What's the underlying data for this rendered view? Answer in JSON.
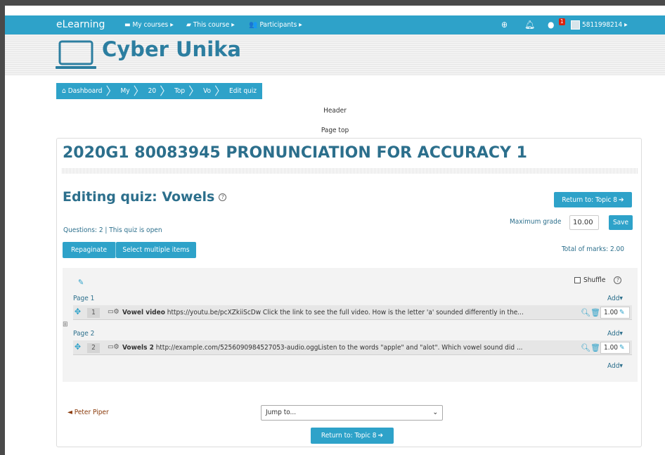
{
  "navbar": {
    "brand": "eLearning",
    "my_courses": "My courses",
    "this_course": "This course",
    "participants": "Participants",
    "message_badge": "1",
    "user_id": "5811998214"
  },
  "header": {
    "site_name": "Cyber Unika"
  },
  "breadcrumb": {
    "items": [
      "Dashboard",
      "My",
      "20",
      "Top",
      "Vo",
      "Edit quiz"
    ]
  },
  "regions": {
    "header_label": "Header",
    "page_top_label": "Page top"
  },
  "course": {
    "title": "2020G1 80083945 PRONUNCIATION FOR ACCURACY 1"
  },
  "quiz": {
    "editing_title": "Editing quiz: Vowels",
    "return_button": "Return to: Topic 8",
    "questions_info": "Questions: 2 | This quiz is open",
    "max_grade_label": "Maximum grade",
    "max_grade_value": "10.00",
    "save_button": "Save",
    "repaginate_button": "Repaginate",
    "select_multiple_button": "Select multiple items",
    "total_marks": "Total of marks: 2.00",
    "shuffle_label": "Shuffle",
    "add_label": "Add",
    "pages": [
      {
        "label": "Page 1",
        "question": {
          "number": "1",
          "name": "Vowel video",
          "text": "https://youtu.be/pcXZkiiScDw Click the link to see the full video. How is the letter 'a' sounded differently in the...",
          "mark": "1.00"
        }
      },
      {
        "label": "Page 2",
        "question": {
          "number": "2",
          "name": "Vowels 2",
          "text": "http://example.com/5256090984527053-audio.oggListen to the words \"apple\" and \"alot\". Which vowel sound did ...",
          "mark": "1.00"
        }
      }
    ]
  },
  "footer_nav": {
    "prev_link": "◄ Peter Piper",
    "jump_placeholder": "Jump to...",
    "return_button": "Return to: Topic 8"
  },
  "colors": {
    "primary": "#2ea2c9",
    "title": "#2c6f8c",
    "badge": "#d9230f"
  }
}
